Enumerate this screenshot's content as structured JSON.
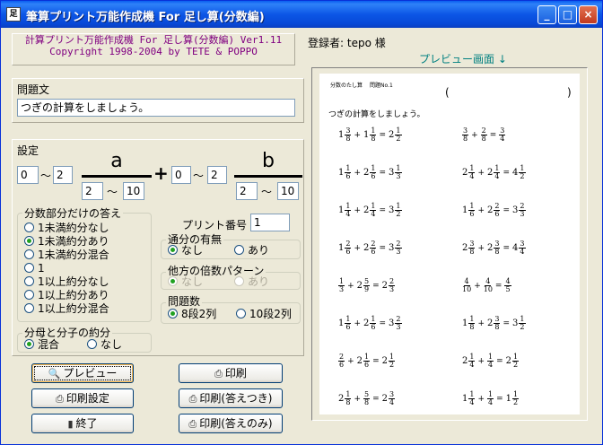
{
  "window": {
    "title": "筆算プリント万能作成機 For 足し算(分数編)",
    "app_icon": "足",
    "min_label": "_",
    "max_label": "□",
    "close_label": "×"
  },
  "header": {
    "line1": "計算プリント万能作成機 For 足し算(分数編) Ver1.11",
    "line2": "Copyright 1998-2004 by TETE & POPPO"
  },
  "registrant": {
    "label": "登録者: tepo 様"
  },
  "preview_label": "プレビュー画面 ↓",
  "question": {
    "label": "問題文",
    "value": "つぎの計算をしましょう。"
  },
  "settings": {
    "label": "設定",
    "a_letter": "a",
    "b_letter": "b",
    "plus": "+",
    "tilde": "〜",
    "a_whole_min": "0",
    "a_whole_max": "2",
    "a_denom_min": "2",
    "a_denom_max": "10",
    "b_whole_min": "0",
    "b_whole_max": "2",
    "b_denom_min": "2",
    "b_denom_max": "10"
  },
  "answer_group": {
    "label": "分数部分だけの答え",
    "options": [
      "1未満約分なし",
      "1未満約分あり",
      "1未満約分混合",
      "1",
      "1以上約分なし",
      "1以上約分あり",
      "1以上約分混合"
    ],
    "selected_index": 1
  },
  "reduce_group": {
    "label": "分母と分子の約分",
    "options": [
      "混合",
      "なし"
    ],
    "selected_index": 0
  },
  "print_number": {
    "label": "プリント番号",
    "value": "1"
  },
  "common_denom_group": {
    "label": "通分の有無",
    "options": [
      "なし",
      "あり"
    ],
    "selected_index": 0
  },
  "multiple_pattern_group": {
    "label": "他方の倍数パターン",
    "options": [
      "なし",
      "あり"
    ],
    "selected_index": 0
  },
  "problem_count_group": {
    "label": "問題数",
    "options": [
      "8段2列",
      "10段2列"
    ],
    "selected_index": 0
  },
  "buttons": {
    "preview": "プレビュー",
    "print_settings": "印刷設定",
    "exit": "終了",
    "print": "印刷",
    "print_with_answers": "印刷(答えつき)",
    "print_answers_only": "印刷(答えのみ)"
  },
  "paper": {
    "header_left": "分数のたし算",
    "header_number": "問題No.1",
    "paren_open": "(",
    "paren_close": ")",
    "instruction": "つぎの計算をしましょう。",
    "left_column": [
      {
        "a": [
          "1",
          "3",
          "8"
        ],
        "b": [
          "1",
          "1",
          "8"
        ],
        "ans": [
          "2",
          "1",
          "2"
        ]
      },
      {
        "a": [
          "1",
          "1",
          "6"
        ],
        "b": [
          "2",
          "1",
          "6"
        ],
        "ans": [
          "3",
          "1",
          "3"
        ]
      },
      {
        "a": [
          "1",
          "1",
          "4"
        ],
        "b": [
          "2",
          "1",
          "4"
        ],
        "ans": [
          "3",
          "1",
          "2"
        ]
      },
      {
        "a": [
          "1",
          "2",
          "6"
        ],
        "b": [
          "2",
          "2",
          "6"
        ],
        "ans": [
          "3",
          "2",
          "3"
        ]
      },
      {
        "a": [
          "",
          "1",
          "3"
        ],
        "b": [
          "2",
          "5",
          "9"
        ],
        "ans": [
          "2",
          "2",
          "3"
        ]
      },
      {
        "a": [
          "1",
          "1",
          "6"
        ],
        "b": [
          "2",
          "1",
          "6"
        ],
        "ans": [
          "3",
          "2",
          "3"
        ]
      },
      {
        "a": [
          "",
          "2",
          "6"
        ],
        "b": [
          "2",
          "1",
          "6"
        ],
        "ans": [
          "2",
          "1",
          "2"
        ]
      },
      {
        "a": [
          "2",
          "1",
          "8"
        ],
        "b": [
          "",
          "5",
          "8"
        ],
        "ans": [
          "2",
          "3",
          "4"
        ]
      }
    ],
    "right_column": [
      {
        "a": [
          "",
          "3",
          "8"
        ],
        "b": [
          "",
          "2",
          "8"
        ],
        "ans": [
          "",
          "3",
          "4"
        ]
      },
      {
        "a": [
          "2",
          "1",
          "4"
        ],
        "b": [
          "2",
          "1",
          "4"
        ],
        "ans": [
          "4",
          "1",
          "2"
        ]
      },
      {
        "a": [
          "1",
          "1",
          "6"
        ],
        "b": [
          "2",
          "2",
          "6"
        ],
        "ans": [
          "3",
          "2",
          "3"
        ]
      },
      {
        "a": [
          "2",
          "3",
          "8"
        ],
        "b": [
          "2",
          "3",
          "8"
        ],
        "ans": [
          "4",
          "3",
          "4"
        ]
      },
      {
        "a": [
          "",
          "4",
          "10"
        ],
        "b": [
          "",
          "4",
          "10"
        ],
        "ans": [
          "",
          "4",
          "5"
        ]
      },
      {
        "a": [
          "1",
          "1",
          "8"
        ],
        "b": [
          "2",
          "3",
          "8"
        ],
        "ans": [
          "3",
          "1",
          "2"
        ]
      },
      {
        "a": [
          "2",
          "1",
          "4"
        ],
        "b": [
          "",
          "1",
          "4"
        ],
        "ans": [
          "2",
          "1",
          "2"
        ]
      },
      {
        "a": [
          "1",
          "1",
          "4"
        ],
        "b": [
          "",
          "1",
          "4"
        ],
        "ans": [
          "1",
          "1",
          "2"
        ]
      }
    ],
    "plus": "+",
    "equals": "="
  }
}
